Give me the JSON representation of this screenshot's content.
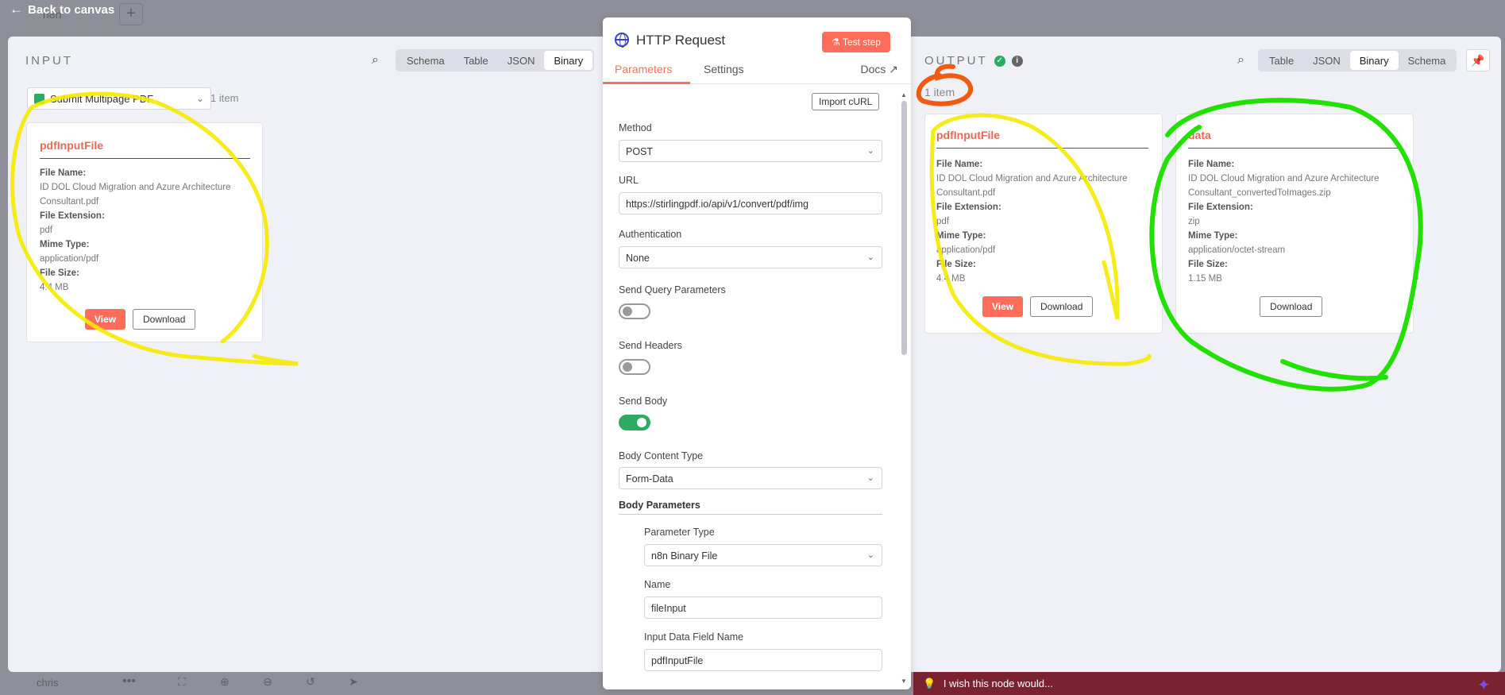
{
  "background": {
    "back_label": "Back to canvas",
    "tab_name": "n8n",
    "plus": "+",
    "user": "chris",
    "more": "•••",
    "feedback": "I wish this node would..."
  },
  "input": {
    "title": "INPUT",
    "tabs": [
      "Schema",
      "Table",
      "JSON",
      "Binary"
    ],
    "active_tab": "Binary",
    "node": "Submit Multipage PDF",
    "item_count": "1 item",
    "card": {
      "name": "pdfInputFile",
      "file_name_label": "File Name:",
      "file_name": "ID DOL Cloud Migration and Azure Architecture Consultant.pdf",
      "ext_label": "File Extension:",
      "ext": "pdf",
      "mime_label": "Mime Type:",
      "mime": "application/pdf",
      "size_label": "File Size:",
      "size": "4.4 MB",
      "view": "View",
      "download": "Download"
    }
  },
  "panel": {
    "title": "HTTP Request",
    "test_label": "Test step",
    "tabs": [
      "Parameters",
      "Settings"
    ],
    "docs": "Docs",
    "import": "Import cURL",
    "method_label": "Method",
    "method": "POST",
    "url_label": "URL",
    "url": "https://stirlingpdf.io/api/v1/convert/pdf/img",
    "auth_label": "Authentication",
    "auth": "None",
    "query_label": "Send Query Parameters",
    "query_on": false,
    "headers_label": "Send Headers",
    "headers_on": false,
    "body_label": "Send Body",
    "body_on": true,
    "content_type_label": "Body Content Type",
    "content_type": "Form-Data",
    "body_params_label": "Body Parameters",
    "param_type_label": "Parameter Type",
    "param_type": "n8n Binary File",
    "name_label": "Name",
    "name": "fileInput",
    "input_field_label": "Input Data Field Name",
    "input_field": "pdfInputFile"
  },
  "output": {
    "title": "OUTPUT",
    "tabs": [
      "Table",
      "JSON",
      "Binary",
      "Schema"
    ],
    "active_tab": "Binary",
    "item_count": "1 item",
    "cards": [
      {
        "name": "pdfInputFile",
        "file_name_label": "File Name:",
        "file_name": "ID DOL Cloud Migration and Azure Architecture Consultant.pdf",
        "ext_label": "File Extension:",
        "ext": "pdf",
        "mime_label": "Mime Type:",
        "mime": "application/pdf",
        "size_label": "File Size:",
        "size": "4.4 MB",
        "view": "View",
        "download": "Download"
      },
      {
        "name": "data",
        "file_name_label": "File Name:",
        "file_name": "ID DOL Cloud Migration and Azure Architecture Consultant_convertedToImages.zip",
        "ext_label": "File Extension:",
        "ext": "zip",
        "mime_label": "Mime Type:",
        "mime": "application/octet-stream",
        "size_label": "File Size:",
        "size": "1.15 MB",
        "download": "Download"
      }
    ]
  },
  "colors": {
    "accent": "#ff6d5a",
    "success": "#2faa62",
    "highlight_yellow": "#f5ea00",
    "highlight_green": "#22e000",
    "highlight_orange": "#f25a12"
  }
}
